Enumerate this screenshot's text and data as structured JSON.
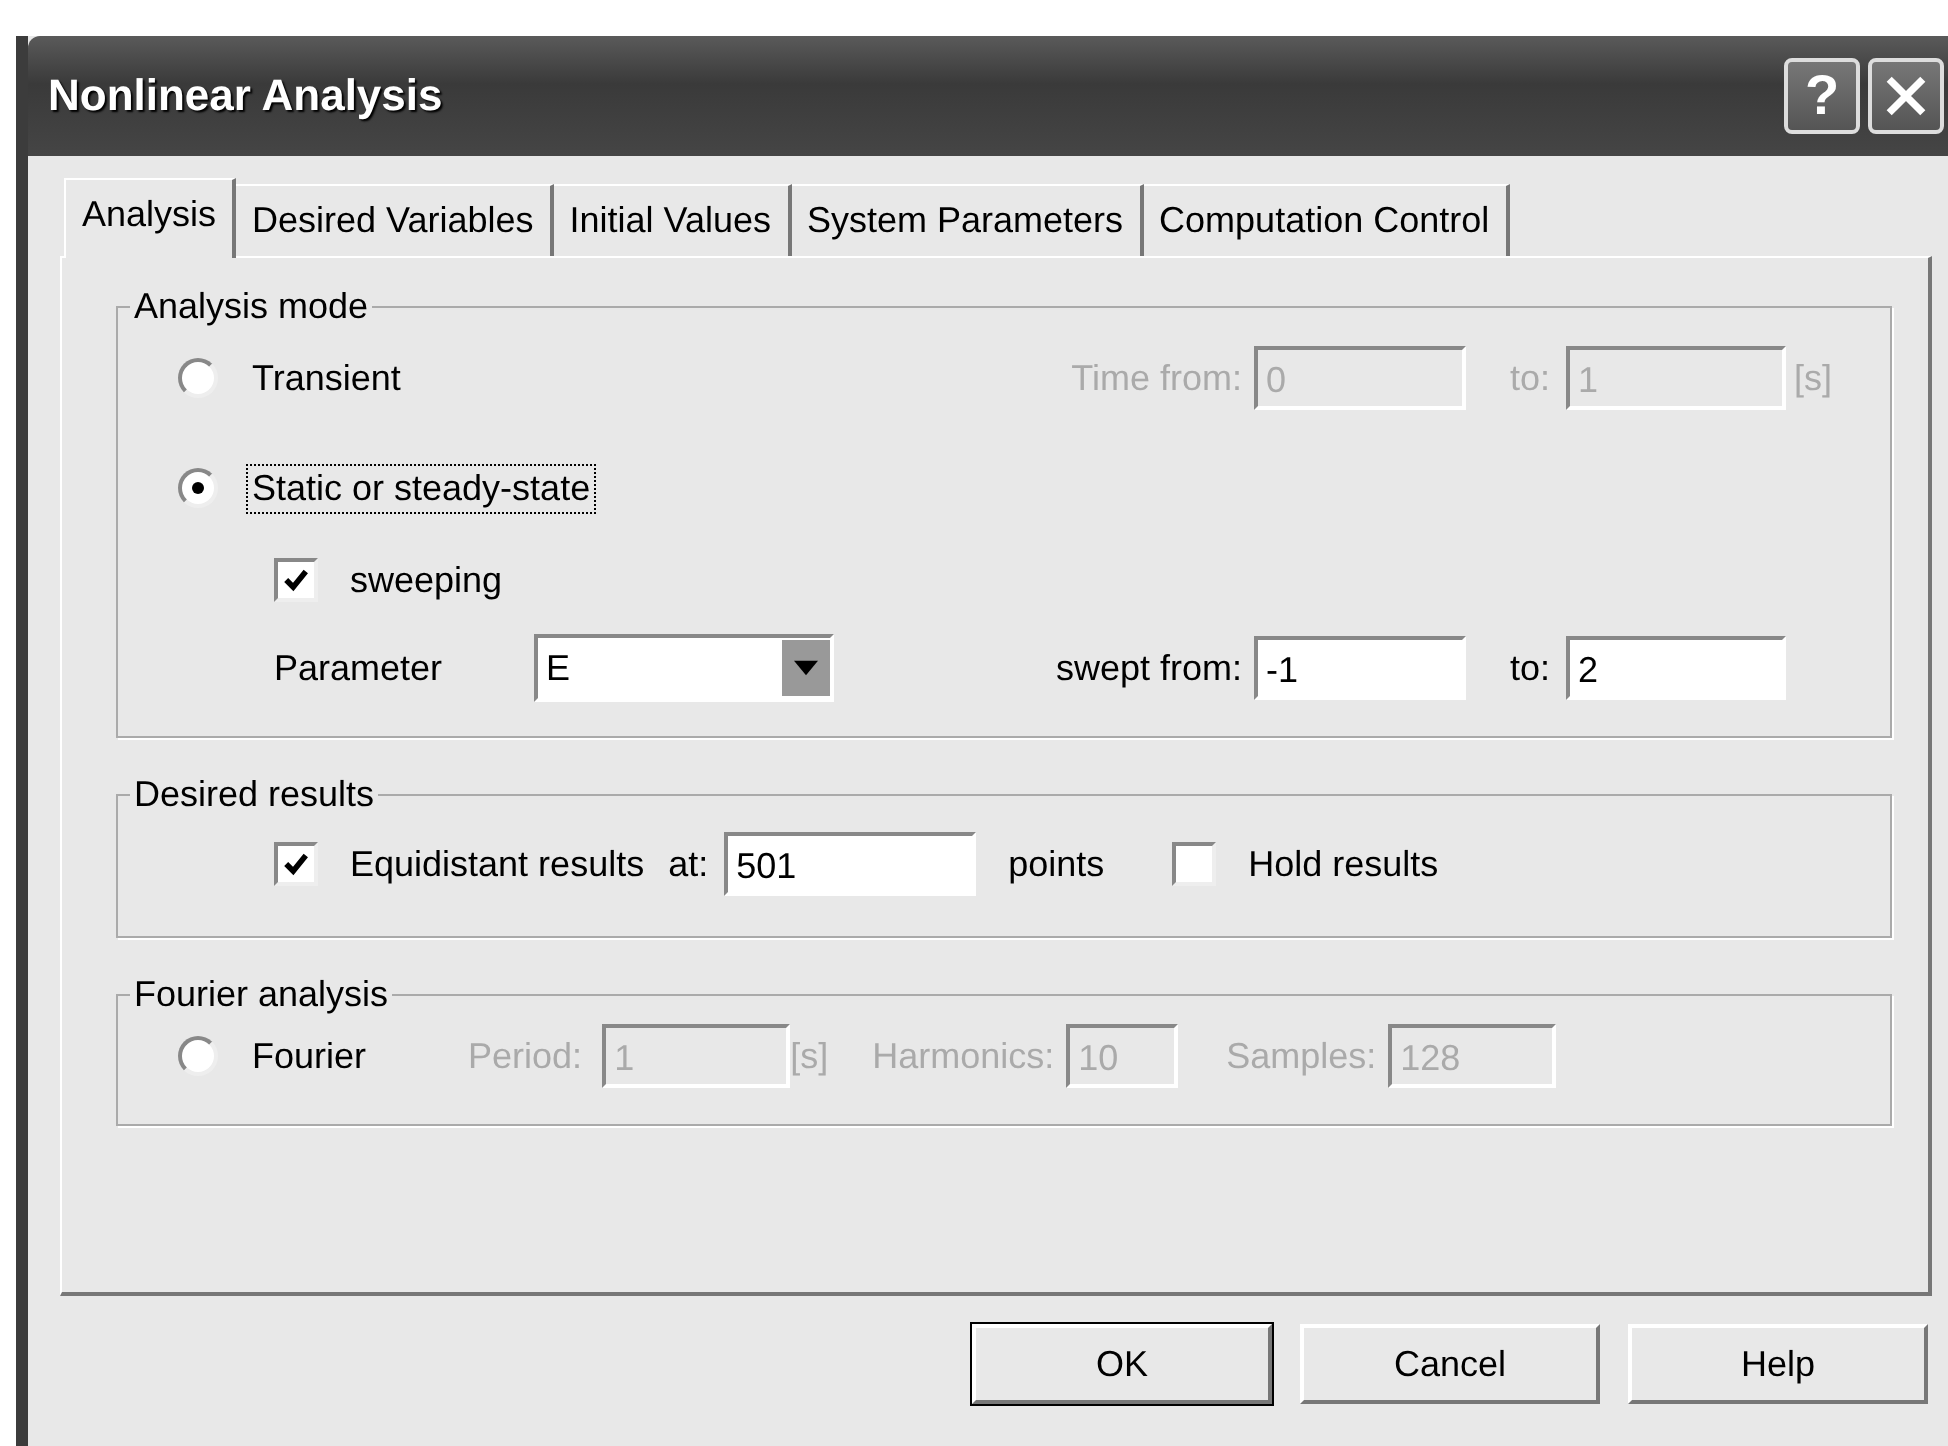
{
  "window": {
    "title": "Nonlinear Analysis",
    "help_label": "?"
  },
  "tabs": [
    {
      "label": "Analysis",
      "selected": true
    },
    {
      "label": "Desired Variables",
      "selected": false
    },
    {
      "label": "Initial Values",
      "selected": false
    },
    {
      "label": "System Parameters",
      "selected": false
    },
    {
      "label": "Computation Control",
      "selected": false
    }
  ],
  "analysis_mode": {
    "title": "Analysis mode",
    "transient": {
      "label": "Transient",
      "selected": false,
      "focused": false,
      "disabled": true,
      "time_from_label": "Time from:",
      "time_from": "0",
      "to_label": "to:",
      "to": "1",
      "unit": "[s]"
    },
    "static": {
      "label": "Static or steady-state",
      "selected": true,
      "focused": true
    },
    "sweeping": {
      "label": "sweeping",
      "checked": true
    },
    "parameter": {
      "label": "Parameter",
      "value": "E",
      "from_label": "swept from:",
      "from": "-1",
      "to_label": "to:",
      "to": "2"
    }
  },
  "desired_results": {
    "title": "Desired results",
    "equidistant": {
      "label": "Equidistant results",
      "checked": true
    },
    "at_label": "at:",
    "at": "501",
    "points_label": "points",
    "hold": {
      "label": "Hold results",
      "checked": false
    }
  },
  "fourier_analysis": {
    "title": "Fourier analysis",
    "fourier": {
      "label": "Fourier",
      "selected": false,
      "focused": false
    },
    "disabled": true,
    "period_label": "Period:",
    "period": "1",
    "period_unit": "[s]",
    "harmonics_label": "Harmonics:",
    "harmonics": "10",
    "samples_label": "Samples:",
    "samples": "128"
  },
  "buttons": [
    {
      "label": "OK",
      "default": true
    },
    {
      "label": "Cancel",
      "default": false
    },
    {
      "label": "Help",
      "default": false
    }
  ]
}
